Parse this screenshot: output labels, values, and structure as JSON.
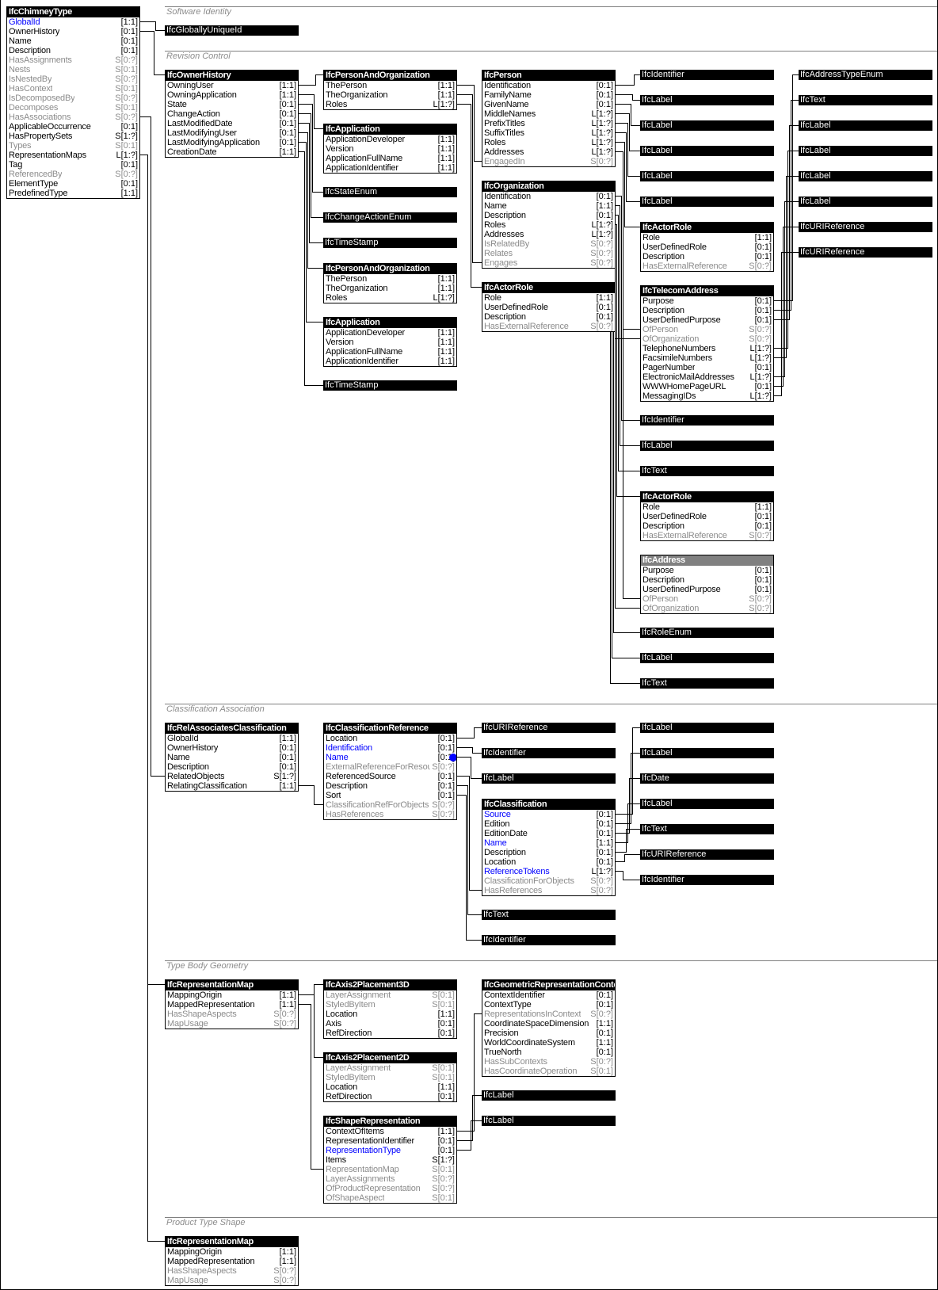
{
  "sections": [
    "Software Identity",
    "Revision Control",
    "Classification Association",
    "Type Body Geometry",
    "Product Type Shape"
  ],
  "colors": {
    "inverse_attribute": "#8c8c8c",
    "highlighted_attribute": "#0000ff",
    "abstract_header": "#808080",
    "header": "#000000"
  },
  "entities": [
    {
      "title": "IfcChimneyType",
      "abstract": false,
      "attributes": [
        {
          "name": "GlobalId",
          "card": "[1:1]",
          "kind": "b"
        },
        {
          "name": "OwnerHistory",
          "card": "[0:1]",
          "kind": "n"
        },
        {
          "name": "Name",
          "card": "[0:1]",
          "kind": "n"
        },
        {
          "name": "Description",
          "card": "[0:1]",
          "kind": "n"
        },
        {
          "name": "HasAssignments",
          "card": "S[0:?]",
          "kind": "d"
        },
        {
          "name": "Nests",
          "card": "S[0:1]",
          "kind": "d"
        },
        {
          "name": "IsNestedBy",
          "card": "S[0:?]",
          "kind": "d"
        },
        {
          "name": "HasContext",
          "card": "S[0:1]",
          "kind": "d"
        },
        {
          "name": "IsDecomposedBy",
          "card": "S[0:?]",
          "kind": "d"
        },
        {
          "name": "Decomposes",
          "card": "S[0:1]",
          "kind": "d"
        },
        {
          "name": "HasAssociations",
          "card": "S[0:?]",
          "kind": "d"
        },
        {
          "name": "ApplicableOccurrence",
          "card": "[0:1]",
          "kind": "n"
        },
        {
          "name": "HasPropertySets",
          "card": "S[1:?]",
          "kind": "n"
        },
        {
          "name": "Types",
          "card": "S[0:1]",
          "kind": "d"
        },
        {
          "name": "RepresentationMaps",
          "card": "L[1:?]",
          "kind": "n"
        },
        {
          "name": "Tag",
          "card": "[0:1]",
          "kind": "n"
        },
        {
          "name": "ReferencedBy",
          "card": "S[0:?]",
          "kind": "d"
        },
        {
          "name": "ElementType",
          "card": "[0:1]",
          "kind": "n"
        },
        {
          "name": "PredefinedType",
          "card": "[1:1]",
          "kind": "n"
        }
      ]
    },
    {
      "title": "IfcOwnerHistory",
      "abstract": false,
      "attributes": [
        {
          "name": "OwningUser",
          "card": "[1:1]",
          "kind": "n"
        },
        {
          "name": "OwningApplication",
          "card": "[1:1]",
          "kind": "n"
        },
        {
          "name": "State",
          "card": "[0:1]",
          "kind": "n"
        },
        {
          "name": "ChangeAction",
          "card": "[0:1]",
          "kind": "n"
        },
        {
          "name": "LastModifiedDate",
          "card": "[0:1]",
          "kind": "n"
        },
        {
          "name": "LastModifyingUser",
          "card": "[0:1]",
          "kind": "n"
        },
        {
          "name": "LastModifyingApplication",
          "card": "[0:1]",
          "kind": "n"
        },
        {
          "name": "CreationDate",
          "card": "[1:1]",
          "kind": "n"
        }
      ]
    },
    {
      "title": "IfcPersonAndOrganization",
      "abstract": false,
      "attributes": [
        {
          "name": "ThePerson",
          "card": "[1:1]",
          "kind": "n"
        },
        {
          "name": "TheOrganization",
          "card": "[1:1]",
          "kind": "n"
        },
        {
          "name": "Roles",
          "card": "L[1:?]",
          "kind": "n"
        }
      ]
    },
    {
      "title": "IfcApplication",
      "abstract": false,
      "attributes": [
        {
          "name": "ApplicationDeveloper",
          "card": "[1:1]",
          "kind": "n"
        },
        {
          "name": "Version",
          "card": "[1:1]",
          "kind": "n"
        },
        {
          "name": "ApplicationFullName",
          "card": "[1:1]",
          "kind": "n"
        },
        {
          "name": "ApplicationIdentifier",
          "card": "[1:1]",
          "kind": "n"
        }
      ]
    },
    {
      "title": "IfcPersonAndOrganization",
      "abstract": false,
      "attributes": [
        {
          "name": "ThePerson",
          "card": "[1:1]",
          "kind": "n"
        },
        {
          "name": "TheOrganization",
          "card": "[1:1]",
          "kind": "n"
        },
        {
          "name": "Roles",
          "card": "L[1:?]",
          "kind": "n"
        }
      ]
    },
    {
      "title": "IfcApplication",
      "abstract": false,
      "attributes": [
        {
          "name": "ApplicationDeveloper",
          "card": "[1:1]",
          "kind": "n"
        },
        {
          "name": "Version",
          "card": "[1:1]",
          "kind": "n"
        },
        {
          "name": "ApplicationFullName",
          "card": "[1:1]",
          "kind": "n"
        },
        {
          "name": "ApplicationIdentifier",
          "card": "[1:1]",
          "kind": "n"
        }
      ]
    },
    {
      "title": "IfcPerson",
      "abstract": false,
      "attributes": [
        {
          "name": "Identification",
          "card": "[0:1]",
          "kind": "n"
        },
        {
          "name": "FamilyName",
          "card": "[0:1]",
          "kind": "n"
        },
        {
          "name": "GivenName",
          "card": "[0:1]",
          "kind": "n"
        },
        {
          "name": "MiddleNames",
          "card": "L[1:?]",
          "kind": "n"
        },
        {
          "name": "PrefixTitles",
          "card": "L[1:?]",
          "kind": "n"
        },
        {
          "name": "SuffixTitles",
          "card": "L[1:?]",
          "kind": "n"
        },
        {
          "name": "Roles",
          "card": "L[1:?]",
          "kind": "n"
        },
        {
          "name": "Addresses",
          "card": "L[1:?]",
          "kind": "n"
        },
        {
          "name": "EngagedIn",
          "card": "S[0:?]",
          "kind": "d"
        }
      ]
    },
    {
      "title": "IfcOrganization",
      "abstract": false,
      "attributes": [
        {
          "name": "Identification",
          "card": "[0:1]",
          "kind": "n"
        },
        {
          "name": "Name",
          "card": "[1:1]",
          "kind": "n"
        },
        {
          "name": "Description",
          "card": "[0:1]",
          "kind": "n"
        },
        {
          "name": "Roles",
          "card": "L[1:?]",
          "kind": "n"
        },
        {
          "name": "Addresses",
          "card": "L[1:?]",
          "kind": "n"
        },
        {
          "name": "IsRelatedBy",
          "card": "S[0:?]",
          "kind": "d"
        },
        {
          "name": "Relates",
          "card": "S[0:?]",
          "kind": "d"
        },
        {
          "name": "Engages",
          "card": "S[0:?]",
          "kind": "d"
        }
      ]
    },
    {
      "title": "IfcActorRole",
      "abstract": false,
      "attributes": [
        {
          "name": "Role",
          "card": "[1:1]",
          "kind": "n"
        },
        {
          "name": "UserDefinedRole",
          "card": "[0:1]",
          "kind": "n"
        },
        {
          "name": "Description",
          "card": "[0:1]",
          "kind": "n"
        },
        {
          "name": "HasExternalReference",
          "card": "S[0:?]",
          "kind": "d"
        }
      ]
    },
    {
      "title": "IfcActorRole",
      "abstract": false,
      "attributes": [
        {
          "name": "Role",
          "card": "[1:1]",
          "kind": "n"
        },
        {
          "name": "UserDefinedRole",
          "card": "[0:1]",
          "kind": "n"
        },
        {
          "name": "Description",
          "card": "[0:1]",
          "kind": "n"
        },
        {
          "name": "HasExternalReference",
          "card": "S[0:?]",
          "kind": "d"
        }
      ]
    },
    {
      "title": "IfcTelecomAddress",
      "abstract": false,
      "attributes": [
        {
          "name": "Purpose",
          "card": "[0:1]",
          "kind": "n"
        },
        {
          "name": "Description",
          "card": "[0:1]",
          "kind": "n"
        },
        {
          "name": "UserDefinedPurpose",
          "card": "[0:1]",
          "kind": "n"
        },
        {
          "name": "OfPerson",
          "card": "S[0:?]",
          "kind": "d"
        },
        {
          "name": "OfOrganization",
          "card": "S[0:?]",
          "kind": "d"
        },
        {
          "name": "TelephoneNumbers",
          "card": "L[1:?]",
          "kind": "n"
        },
        {
          "name": "FacsimileNumbers",
          "card": "L[1:?]",
          "kind": "n"
        },
        {
          "name": "PagerNumber",
          "card": "[0:1]",
          "kind": "n"
        },
        {
          "name": "ElectronicMailAddresses",
          "card": "L[1:?]",
          "kind": "n"
        },
        {
          "name": "WWWHomePageURL",
          "card": "[0:1]",
          "kind": "n"
        },
        {
          "name": "MessagingIDs",
          "card": "L[1:?]",
          "kind": "n"
        }
      ]
    },
    {
      "title": "IfcActorRole",
      "abstract": false,
      "attributes": [
        {
          "name": "Role",
          "card": "[1:1]",
          "kind": "n"
        },
        {
          "name": "UserDefinedRole",
          "card": "[0:1]",
          "kind": "n"
        },
        {
          "name": "Description",
          "card": "[0:1]",
          "kind": "n"
        },
        {
          "name": "HasExternalReference",
          "card": "S[0:?]",
          "kind": "d"
        }
      ]
    },
    {
      "title": "IfcAddress",
      "abstract": true,
      "attributes": [
        {
          "name": "Purpose",
          "card": "[0:1]",
          "kind": "n"
        },
        {
          "name": "Description",
          "card": "[0:1]",
          "kind": "n"
        },
        {
          "name": "UserDefinedPurpose",
          "card": "[0:1]",
          "kind": "n"
        },
        {
          "name": "OfPerson",
          "card": "S[0:?]",
          "kind": "d"
        },
        {
          "name": "OfOrganization",
          "card": "S[0:?]",
          "kind": "d"
        }
      ]
    },
    {
      "title": "IfcRelAssociatesClassification",
      "abstract": false,
      "attributes": [
        {
          "name": "GlobalId",
          "card": "[1:1]",
          "kind": "n"
        },
        {
          "name": "OwnerHistory",
          "card": "[0:1]",
          "kind": "n"
        },
        {
          "name": "Name",
          "card": "[0:1]",
          "kind": "n"
        },
        {
          "name": "Description",
          "card": "[0:1]",
          "kind": "n"
        },
        {
          "name": "RelatedObjects",
          "card": "S[1:?]",
          "kind": "n"
        },
        {
          "name": "RelatingClassification",
          "card": "[1:1]",
          "kind": "n"
        }
      ]
    },
    {
      "title": "IfcClassificationReference",
      "abstract": false,
      "attributes": [
        {
          "name": "Location",
          "card": "[0:1]",
          "kind": "n"
        },
        {
          "name": "Identification",
          "card": "[0:1]",
          "kind": "b"
        },
        {
          "name": "Name",
          "card": "[0:1]",
          "kind": "b",
          "marker": true
        },
        {
          "name": "ExternalReferenceForResources",
          "card": "S[0:?]",
          "kind": "d"
        },
        {
          "name": "ReferencedSource",
          "card": "[0:1]",
          "kind": "n"
        },
        {
          "name": "Description",
          "card": "[0:1]",
          "kind": "n"
        },
        {
          "name": "Sort",
          "card": "[0:1]",
          "kind": "n"
        },
        {
          "name": "ClassificationRefForObjects",
          "card": "S[0:?]",
          "kind": "d"
        },
        {
          "name": "HasReferences",
          "card": "S[0:?]",
          "kind": "d"
        }
      ]
    },
    {
      "title": "IfcClassification",
      "abstract": false,
      "attributes": [
        {
          "name": "Source",
          "card": "[0:1]",
          "kind": "b"
        },
        {
          "name": "Edition",
          "card": "[0:1]",
          "kind": "n"
        },
        {
          "name": "EditionDate",
          "card": "[0:1]",
          "kind": "n"
        },
        {
          "name": "Name",
          "card": "[1:1]",
          "kind": "b"
        },
        {
          "name": "Description",
          "card": "[0:1]",
          "kind": "n"
        },
        {
          "name": "Location",
          "card": "[0:1]",
          "kind": "n"
        },
        {
          "name": "ReferenceTokens",
          "card": "L[1:?]",
          "kind": "b"
        },
        {
          "name": "ClassificationForObjects",
          "card": "S[0:?]",
          "kind": "d"
        },
        {
          "name": "HasReferences",
          "card": "S[0:?]",
          "kind": "d"
        }
      ]
    },
    {
      "title": "IfcRepresentationMap",
      "abstract": false,
      "attributes": [
        {
          "name": "MappingOrigin",
          "card": "[1:1]",
          "kind": "n"
        },
        {
          "name": "MappedRepresentation",
          "card": "[1:1]",
          "kind": "n"
        },
        {
          "name": "HasShapeAspects",
          "card": "S[0:?]",
          "kind": "d"
        },
        {
          "name": "MapUsage",
          "card": "S[0:?]",
          "kind": "d"
        }
      ]
    },
    {
      "title": "IfcAxis2Placement3D",
      "abstract": false,
      "attributes": [
        {
          "name": "LayerAssignment",
          "card": "S[0:1]",
          "kind": "d"
        },
        {
          "name": "StyledByItem",
          "card": "S[0:1]",
          "kind": "d"
        },
        {
          "name": "Location",
          "card": "[1:1]",
          "kind": "n"
        },
        {
          "name": "Axis",
          "card": "[0:1]",
          "kind": "n"
        },
        {
          "name": "RefDirection",
          "card": "[0:1]",
          "kind": "n"
        }
      ]
    },
    {
      "title": "IfcAxis2Placement2D",
      "abstract": false,
      "attributes": [
        {
          "name": "LayerAssignment",
          "card": "S[0:1]",
          "kind": "d"
        },
        {
          "name": "StyledByItem",
          "card": "S[0:1]",
          "kind": "d"
        },
        {
          "name": "Location",
          "card": "[1:1]",
          "kind": "n"
        },
        {
          "name": "RefDirection",
          "card": "[0:1]",
          "kind": "n"
        }
      ]
    },
    {
      "title": "IfcShapeRepresentation",
      "abstract": false,
      "attributes": [
        {
          "name": "ContextOfItems",
          "card": "[1:1]",
          "kind": "n"
        },
        {
          "name": "RepresentationIdentifier",
          "card": "[0:1]",
          "kind": "n"
        },
        {
          "name": "RepresentationType",
          "card": "[0:1]",
          "kind": "b"
        },
        {
          "name": "Items",
          "card": "S[1:?]",
          "kind": "n"
        },
        {
          "name": "RepresentationMap",
          "card": "S[0:1]",
          "kind": "d"
        },
        {
          "name": "LayerAssignments",
          "card": "S[0:?]",
          "kind": "d"
        },
        {
          "name": "OfProductRepresentation",
          "card": "S[0:?]",
          "kind": "d"
        },
        {
          "name": "OfShapeAspect",
          "card": "S[0:1]",
          "kind": "d"
        }
      ]
    },
    {
      "title": "IfcGeometricRepresentationContext",
      "abstract": false,
      "attributes": [
        {
          "name": "ContextIdentifier",
          "card": "[0:1]",
          "kind": "n"
        },
        {
          "name": "ContextType",
          "card": "[0:1]",
          "kind": "n"
        },
        {
          "name": "RepresentationsInContext",
          "card": "S[0:?]",
          "kind": "d"
        },
        {
          "name": "CoordinateSpaceDimension",
          "card": "[1:1]",
          "kind": "n"
        },
        {
          "name": "Precision",
          "card": "[0:1]",
          "kind": "n"
        },
        {
          "name": "WorldCoordinateSystem",
          "card": "[1:1]",
          "kind": "n"
        },
        {
          "name": "TrueNorth",
          "card": "[0:1]",
          "kind": "n"
        },
        {
          "name": "HasSubContexts",
          "card": "S[0:?]",
          "kind": "d"
        },
        {
          "name": "HasCoordinateOperation",
          "card": "S[0:1]",
          "kind": "d"
        }
      ]
    },
    {
      "title": "IfcRepresentationMap",
      "abstract": false,
      "attributes": [
        {
          "name": "MappingOrigin",
          "card": "[1:1]",
          "kind": "n"
        },
        {
          "name": "MappedRepresentation",
          "card": "[1:1]",
          "kind": "n"
        },
        {
          "name": "HasShapeAspects",
          "card": "S[0:?]",
          "kind": "d"
        },
        {
          "name": "MapUsage",
          "card": "S[0:?]",
          "kind": "d"
        }
      ]
    }
  ],
  "types": [
    "IfcGloballyUniqueId",
    "IfcStateEnum",
    "IfcChangeActionEnum",
    "IfcTimeStamp",
    "IfcTimeStamp",
    "IfcIdentifier",
    "IfcLabel",
    "IfcLabel",
    "IfcLabel",
    "IfcLabel",
    "IfcLabel",
    "IfcAddressTypeEnum",
    "IfcText",
    "IfcLabel",
    "IfcLabel",
    "IfcLabel",
    "IfcLabel",
    "IfcURIReference",
    "IfcURIReference",
    "IfcIdentifier",
    "IfcLabel",
    "IfcText",
    "IfcRoleEnum",
    "IfcLabel",
    "IfcText",
    "IfcURIReference",
    "IfcIdentifier",
    "IfcLabel",
    "IfcText",
    "IfcIdentifier",
    "IfcLabel",
    "IfcLabel",
    "IfcDate",
    "IfcLabel",
    "IfcText",
    "IfcURIReference",
    "IfcIdentifier",
    "IfcLabel",
    "IfcLabel"
  ]
}
